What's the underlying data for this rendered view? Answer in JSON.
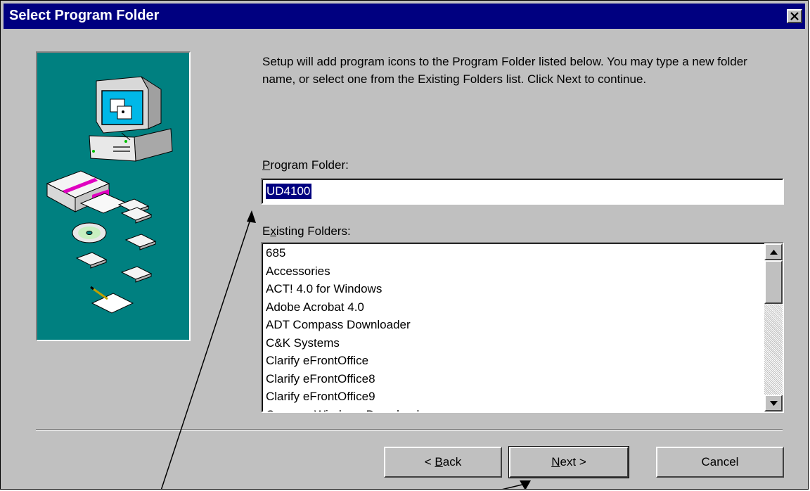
{
  "window": {
    "title": "Select Program Folder",
    "close_glyph": "✕"
  },
  "description": "Setup will add program icons to the Program Folder listed below. You may type a new folder name, or select one from the Existing Folders list. Click Next to continue.",
  "program_folder": {
    "label_mnemonic": "P",
    "label_rest": "rogram Folder:",
    "value": "UD4100"
  },
  "existing_folders": {
    "label_first": "E",
    "label_mnemonic": "x",
    "label_rest": "isting Folders:",
    "items": [
      "685",
      "Accessories",
      "ACT! 4.0 for Windows",
      "Adobe Acrobat 4.0",
      "ADT Compass Downloader",
      "C&K Systems",
      "Clarify eFrontOffice",
      "Clarify eFrontOffice8",
      "Clarify eFrontOffice9",
      "Compaq Windows Downloader"
    ]
  },
  "buttons": {
    "back_prefix": "< ",
    "back_mnemonic": "B",
    "back_rest": "ack",
    "next_mnemonic": "N",
    "next_rest": "ext >",
    "cancel": "Cancel"
  },
  "colors": {
    "titlebar": "#000080",
    "dialog": "#c0c0c0",
    "illustration_bg": "#008080",
    "selection": "#000080"
  },
  "icons": [
    "close-icon",
    "computer-icon",
    "floppy-disk-icon",
    "cd-icon",
    "setup-box-icon",
    "document-pencil-icon",
    "scroll-up-arrow-icon",
    "scroll-down-arrow-icon"
  ]
}
